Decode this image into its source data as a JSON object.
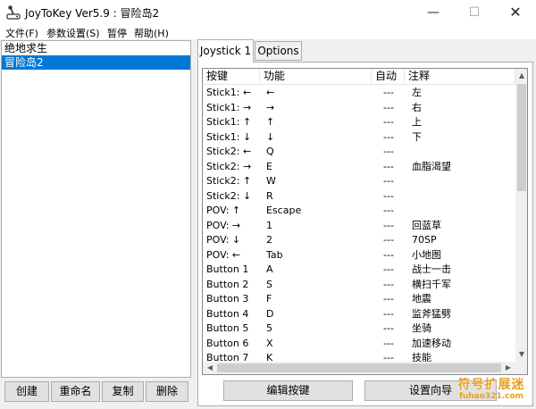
{
  "window": {
    "title": "JoyToKey Ver5.9 : 冒险岛2",
    "minimize_label": "—",
    "maximize_label": "☐",
    "close_label": "✕"
  },
  "menu": {
    "items": [
      "文件(F)",
      "参数设置(S)",
      "暂停",
      "帮助(H)"
    ]
  },
  "profiles": {
    "items": [
      "绝地求生",
      "冒险岛2"
    ],
    "selected_index": 1
  },
  "left_buttons": {
    "create": "创建",
    "rename": "重命名",
    "copy": "复制",
    "delete": "删除"
  },
  "tabs": [
    {
      "label": "Joystick 1",
      "active": true
    },
    {
      "label": "Options",
      "active": false
    }
  ],
  "table": {
    "headers": [
      "按键",
      "功能",
      "自动",
      "注释"
    ],
    "rows": [
      {
        "key": "Stick1: ←",
        "func": "←",
        "auto": "---",
        "note": "左"
      },
      {
        "key": "Stick1: →",
        "func": "→",
        "auto": "---",
        "note": "右"
      },
      {
        "key": "Stick1: ↑",
        "func": "↑",
        "auto": "---",
        "note": "上"
      },
      {
        "key": "Stick1: ↓",
        "func": "↓",
        "auto": "---",
        "note": "下"
      },
      {
        "key": "Stick2: ←",
        "func": "Q",
        "auto": "---",
        "note": ""
      },
      {
        "key": "Stick2: →",
        "func": "E",
        "auto": "---",
        "note": "血脂渴望"
      },
      {
        "key": "Stick2: ↑",
        "func": "W",
        "auto": "---",
        "note": ""
      },
      {
        "key": "Stick2: ↓",
        "func": "R",
        "auto": "---",
        "note": ""
      },
      {
        "key": "POV: ↑",
        "func": "Escape",
        "auto": "---",
        "note": ""
      },
      {
        "key": "POV: →",
        "func": "1",
        "auto": "---",
        "note": "回蓝草"
      },
      {
        "key": "POV: ↓",
        "func": "2",
        "auto": "---",
        "note": "70SP"
      },
      {
        "key": "POV: ←",
        "func": "Tab",
        "auto": "---",
        "note": "小地图"
      },
      {
        "key": "Button 1",
        "func": "A",
        "auto": "---",
        "note": "战士一击"
      },
      {
        "key": "Button 2",
        "func": "S",
        "auto": "---",
        "note": "横扫千军"
      },
      {
        "key": "Button 3",
        "func": "F",
        "auto": "---",
        "note": "地震"
      },
      {
        "key": "Button 4",
        "func": "D",
        "auto": "---",
        "note": "监斧猛劈"
      },
      {
        "key": "Button 5",
        "func": "5",
        "auto": "---",
        "note": "坐骑"
      },
      {
        "key": "Button 6",
        "func": "X",
        "auto": "---",
        "note": "加速移动"
      },
      {
        "key": "Button 7",
        "func": "K",
        "auto": "---",
        "note": "技能"
      }
    ]
  },
  "bottom_buttons": {
    "edit": "编辑按键",
    "wizard": "设置向导"
  },
  "watermark": {
    "main": "符号扩展迷",
    "sub": "fuhao321.com"
  },
  "colors": {
    "selection": "#0078d7",
    "watermark": "#e8a020"
  }
}
